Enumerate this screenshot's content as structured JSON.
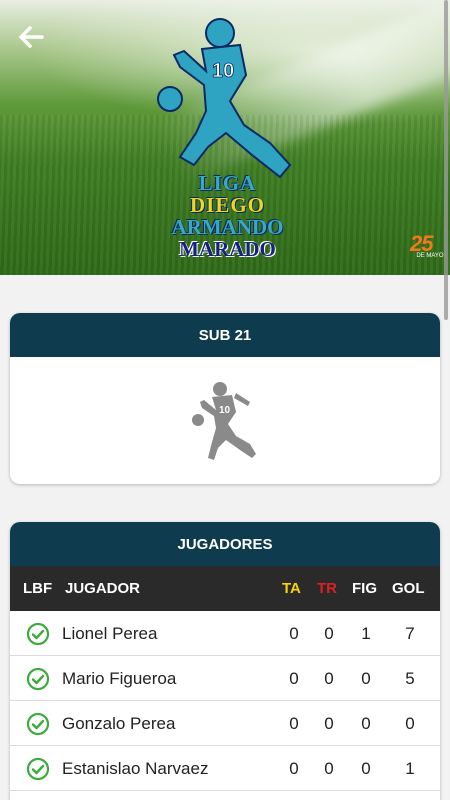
{
  "header": {
    "logo_lines": [
      "LIGA",
      "DIEGO",
      "ARMANDO",
      "MARADO"
    ],
    "sponsor_mark": "25",
    "sponsor_caption": "DE MAYO"
  },
  "team": {
    "category": "SUB 21"
  },
  "players": {
    "title": "JUGADORES",
    "columns": {
      "lbf": "LBF",
      "jugador": "JUGADOR",
      "ta": "TA",
      "tr": "TR",
      "fig": "FIG",
      "gol": "GOL"
    },
    "rows": [
      {
        "name": "Lionel Perea",
        "ta": "0",
        "tr": "0",
        "fig": "1",
        "gol": "7"
      },
      {
        "name": "Mario Figueroa",
        "ta": "0",
        "tr": "0",
        "fig": "0",
        "gol": "5"
      },
      {
        "name": "Gonzalo Perea",
        "ta": "0",
        "tr": "0",
        "fig": "0",
        "gol": "0"
      },
      {
        "name": "Estanislao Narvaez",
        "ta": "0",
        "tr": "0",
        "fig": "0",
        "gol": "1"
      }
    ]
  },
  "colors": {
    "header_bg": "#0e3c4e",
    "table_head_bg": "#2a2a2a",
    "ta_color": "#f5d40f",
    "tr_color": "#e02020",
    "check_color": "#3daa3d"
  },
  "icons": {
    "back": "arrow-left-icon",
    "lbf_status": "check-circle-icon",
    "team_placeholder": "soccer-player-icon"
  }
}
